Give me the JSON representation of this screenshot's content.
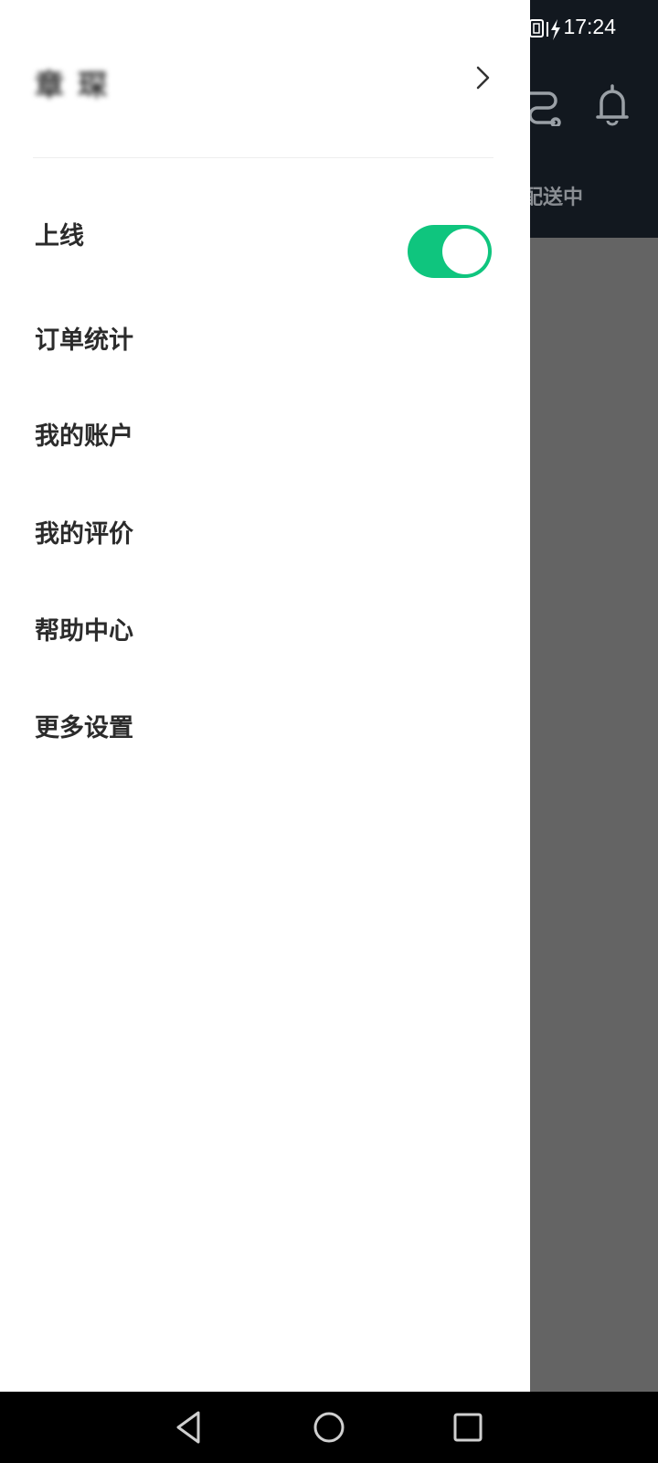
{
  "status_bar": {
    "time": "17:24"
  },
  "background_app": {
    "tab_label": "配送中",
    "header_color": "#12181f",
    "overlay_color": "#646464",
    "icons": [
      "route-icon",
      "bell-icon"
    ]
  },
  "drawer": {
    "profile": {
      "name": "章 琛"
    },
    "online": {
      "label": "上线",
      "toggle_on": true,
      "toggle_color": "#0fc57e"
    },
    "menu": [
      {
        "label": "订单统计"
      },
      {
        "label": "我的账户"
      },
      {
        "label": "我的评价"
      },
      {
        "label": "帮助中心"
      },
      {
        "label": "更多设置"
      }
    ]
  },
  "nav_bar": {
    "buttons": [
      "back-icon",
      "home-icon",
      "recents-icon"
    ]
  }
}
